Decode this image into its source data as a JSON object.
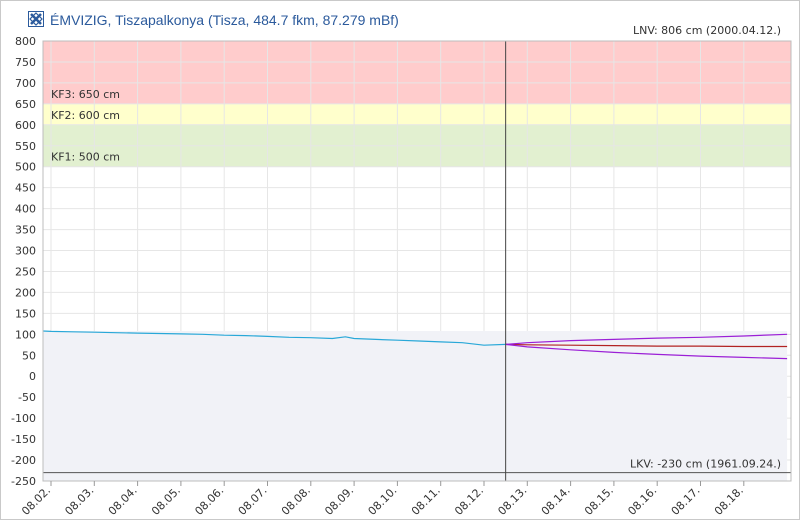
{
  "header": {
    "title": "ÉMVIZIG, Tiszapalkonya (Tisza, 484.7 fkm, 87.279 mBf)",
    "logo_icon": "emvizig-logo-icon"
  },
  "chart_data": {
    "type": "line",
    "title": "ÉMVIZIG, Tiszapalkonya (Tisza, 484.7 fkm, 87.279 mBf)",
    "xlabel": "",
    "ylabel": "",
    "ylim": [
      -250,
      800
    ],
    "yticks": [
      800,
      750,
      700,
      650,
      600,
      550,
      500,
      450,
      400,
      350,
      300,
      250,
      200,
      150,
      100,
      50,
      0,
      -50,
      -100,
      -150,
      -200,
      -250
    ],
    "xticks": [
      "08.02.",
      "08.03.",
      "08.04.",
      "08.05.",
      "08.06.",
      "08.07.",
      "08.08.",
      "08.09.",
      "08.10.",
      "08.11.",
      "08.12.",
      "08.13.",
      "08.14.",
      "08.15.",
      "08.16.",
      "08.17.",
      "08.18."
    ],
    "x_range": [
      0,
      17
    ],
    "grid": true,
    "now_marker_x": 10.5,
    "bands": [
      {
        "name": "KF3: 650 cm",
        "from": 650,
        "to": 800,
        "color": "#ffcccc"
      },
      {
        "name": "KF2: 600 cm",
        "from": 600,
        "to": 650,
        "color": "#ffffcc"
      },
      {
        "name": "KF1: 500 cm",
        "from": 500,
        "to": 600,
        "color": "#e2f0d0"
      }
    ],
    "reference_lines": [
      {
        "label": "LNV: 806 cm (2000.04.12.)",
        "value": 806
      },
      {
        "label": "LKV: -230 cm (1961.09.24.)",
        "value": -230
      }
    ],
    "series": [
      {
        "color": "#29a8d8",
        "x": [
          -0.4,
          0,
          0.5,
          1,
          1.5,
          2,
          2.5,
          3,
          3.5,
          4,
          4.5,
          5,
          5.5,
          6,
          6.5,
          6.8,
          7,
          7.5,
          8,
          8.5,
          9,
          9.5,
          10,
          10.5
        ],
        "values": [
          108,
          107,
          106,
          105,
          104,
          103,
          102,
          101,
          100,
          98,
          97,
          95,
          93,
          92,
          90,
          94,
          90,
          88,
          86,
          84,
          82,
          80,
          74,
          76
        ]
      },
      {
        "color": "#b22222",
        "x": [
          10.5,
          11,
          12,
          13,
          14,
          15,
          16,
          17
        ],
        "values": [
          76,
          75,
          74,
          73,
          72,
          72,
          71,
          71
        ]
      },
      {
        "color": "#9b1fd6",
        "x": [
          10.5,
          11,
          12,
          13,
          14,
          15,
          16,
          17
        ],
        "values": [
          76,
          80,
          85,
          88,
          91,
          93,
          96,
          100
        ]
      },
      {
        "color": "#9b1fd6",
        "x": [
          10.5,
          11,
          12,
          13,
          14,
          15,
          16,
          17
        ],
        "values": [
          76,
          70,
          63,
          57,
          52,
          48,
          45,
          42
        ]
      }
    ]
  }
}
